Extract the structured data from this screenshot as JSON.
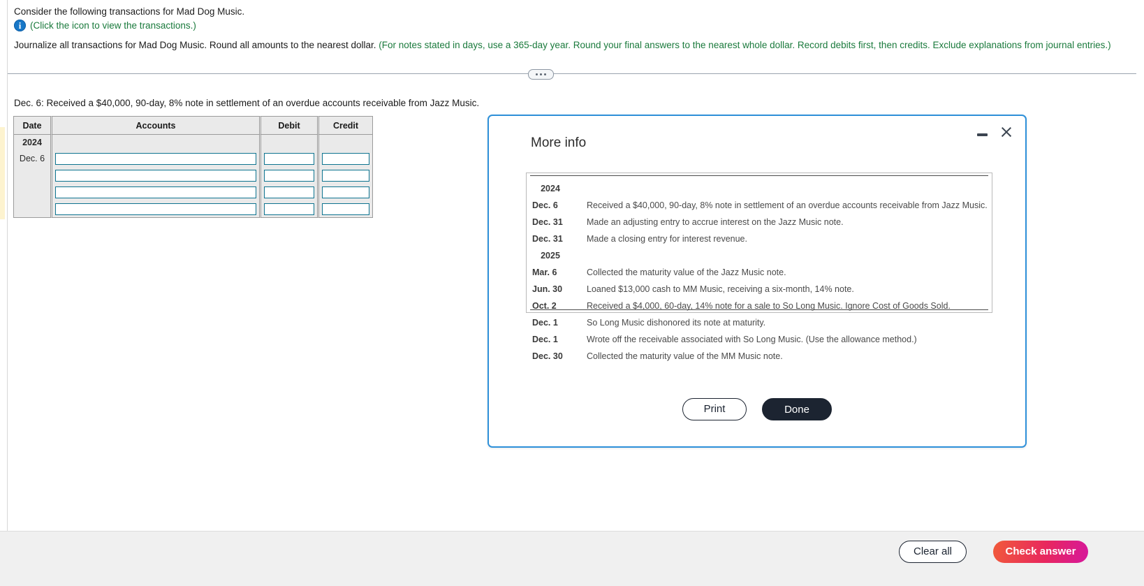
{
  "problem": {
    "prompt": "Consider the following transactions for Mad Dog Music.",
    "icon_link_text": "(Click the icon to view the transactions.)",
    "instruction_black": "Journalize all transactions for Mad Dog Music. Round all amounts to the nearest dollar.",
    "instruction_green": "(For notes stated in days, use a 365-day year. Round your final answers to the nearest whole dollar. Record debits first, then credits. Exclude explanations from journal entries.)",
    "current_transaction": "Dec. 6: Received a $40,000, 90-day, 8% note in settlement of an overdue accounts receivable from Jazz Music."
  },
  "journal": {
    "columns": [
      "Date",
      "Accounts",
      "Debit",
      "Credit"
    ],
    "year": "2024",
    "date": "Dec. 6",
    "rows": [
      {
        "accounts": "",
        "debit": "",
        "credit": ""
      },
      {
        "accounts": "",
        "debit": "",
        "credit": ""
      },
      {
        "accounts": "",
        "debit": "",
        "credit": ""
      },
      {
        "accounts": "",
        "debit": "",
        "credit": ""
      }
    ]
  },
  "modal": {
    "title": "More info",
    "minimize_icon": "minimize-icon",
    "close_icon": "close-icon",
    "transactions": [
      {
        "date": "2024",
        "desc": "",
        "is_year": true
      },
      {
        "date": "Dec. 6",
        "desc": "Received a $40,000, 90-day, 8% note in settlement of an overdue accounts receivable from Jazz Music.",
        "is_year": false
      },
      {
        "date": "Dec. 31",
        "desc": "Made an adjusting entry to accrue interest on the Jazz Music note.",
        "is_year": false
      },
      {
        "date": "Dec. 31",
        "desc": "Made a closing entry for interest revenue.",
        "is_year": false
      },
      {
        "date": "2025",
        "desc": "",
        "is_year": true
      },
      {
        "date": "Mar. 6",
        "desc": "Collected the maturity value of the Jazz Music note.",
        "is_year": false
      },
      {
        "date": "Jun. 30",
        "desc": "Loaned $13,000 cash to MM Music, receiving a six-month, 14% note.",
        "is_year": false
      },
      {
        "date": "Oct. 2",
        "desc": "Received a $4,000, 60-day, 14% note for a sale to So Long Music. Ignore Cost of Goods Sold.",
        "is_year": false
      },
      {
        "date": "Dec. 1",
        "desc": "So Long Music dishonored its note at maturity.",
        "is_year": false
      },
      {
        "date": "Dec. 1",
        "desc": "Wrote off the receivable associated with So Long Music. (Use the allowance method.)",
        "is_year": false
      },
      {
        "date": "Dec. 30",
        "desc": "Collected the maturity value of the MM Music note.",
        "is_year": false
      }
    ],
    "print_label": "Print",
    "done_label": "Done"
  },
  "toolbar": {
    "clear_label": "Clear all",
    "check_label": "Check answer"
  },
  "colors": {
    "modal_border": "#2e90d9",
    "green_text": "#1a7a3c",
    "input_border": "#0e7490",
    "dark_button": "#1c2431",
    "check_gradient_start": "#f15a3a",
    "check_gradient_end": "#d6189c",
    "info_icon": "#1878c8"
  }
}
